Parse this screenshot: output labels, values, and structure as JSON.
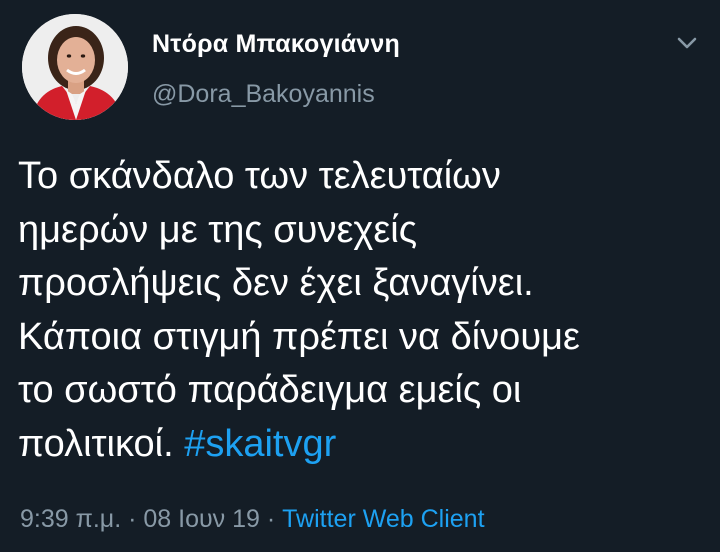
{
  "tweet": {
    "display_name": "Ντόρα Μπακογιάννη",
    "handle": "@Dora_Bakoyannis",
    "text_lines": [
      "Το σκάνδαλο των τελευταίων",
      "ημερών με της συνεχείς",
      "προσλήψεις δεν έχει ξαναγίνει.",
      "Κάποια στιγμή πρέπει να δίνουμε",
      "το σωστό παράδειγμα εμείς οι",
      "πολιτικοί."
    ],
    "hashtag": "#skaitvgr",
    "time": "9:39 π.μ.",
    "separator": "·",
    "date": "08 Ιουν 19",
    "source": "Twitter Web Client"
  },
  "icons": {
    "avatar": "profile-photo",
    "menu": "chevron-down-icon"
  },
  "colors": {
    "background": "#141d26",
    "text": "#ffffff",
    "secondary_text": "#8899a6",
    "link": "#1da1f2"
  }
}
